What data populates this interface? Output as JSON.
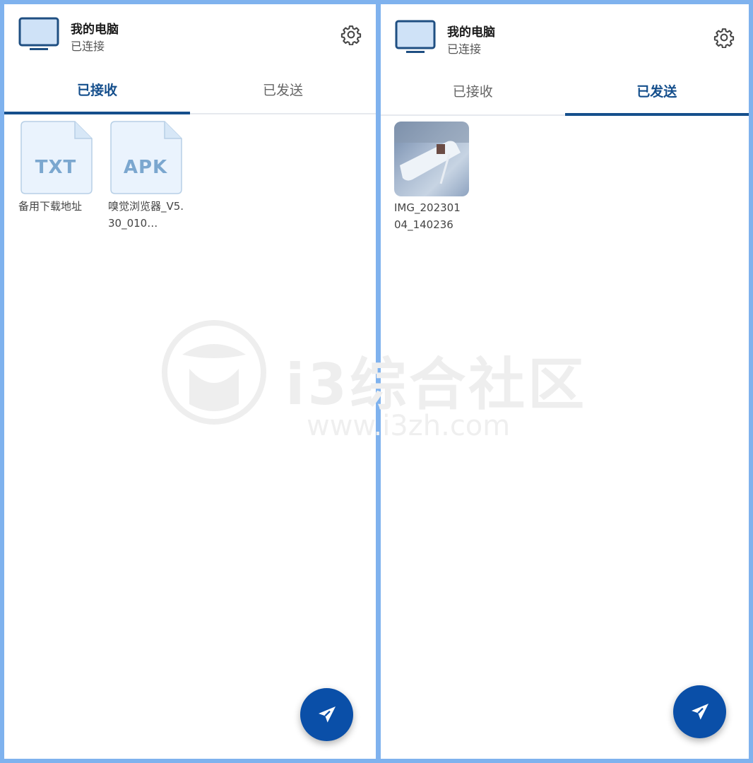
{
  "left": {
    "device_title": "我的电脑",
    "device_status": "已连接",
    "tabs": [
      {
        "label": "已接收",
        "active": true
      },
      {
        "label": "已发送",
        "active": false
      }
    ],
    "files": [
      {
        "ext": "TXT",
        "name": "备用下载地址"
      },
      {
        "ext": "APK",
        "name": "嗅觉浏览器_V5.30_010…"
      }
    ]
  },
  "right": {
    "device_title": "我的电脑",
    "device_status": "已连接",
    "tabs": [
      {
        "label": "已接收",
        "active": false
      },
      {
        "label": "已发送",
        "active": true
      }
    ],
    "files": [
      {
        "name": "IMG_20230104_140236"
      }
    ]
  },
  "watermark": {
    "text": "i3综合社区",
    "url": "www.i3zh.com"
  },
  "colors": {
    "accent": "#154f8c",
    "fab": "#0a4fa8",
    "frame": "#7fb2ee"
  }
}
